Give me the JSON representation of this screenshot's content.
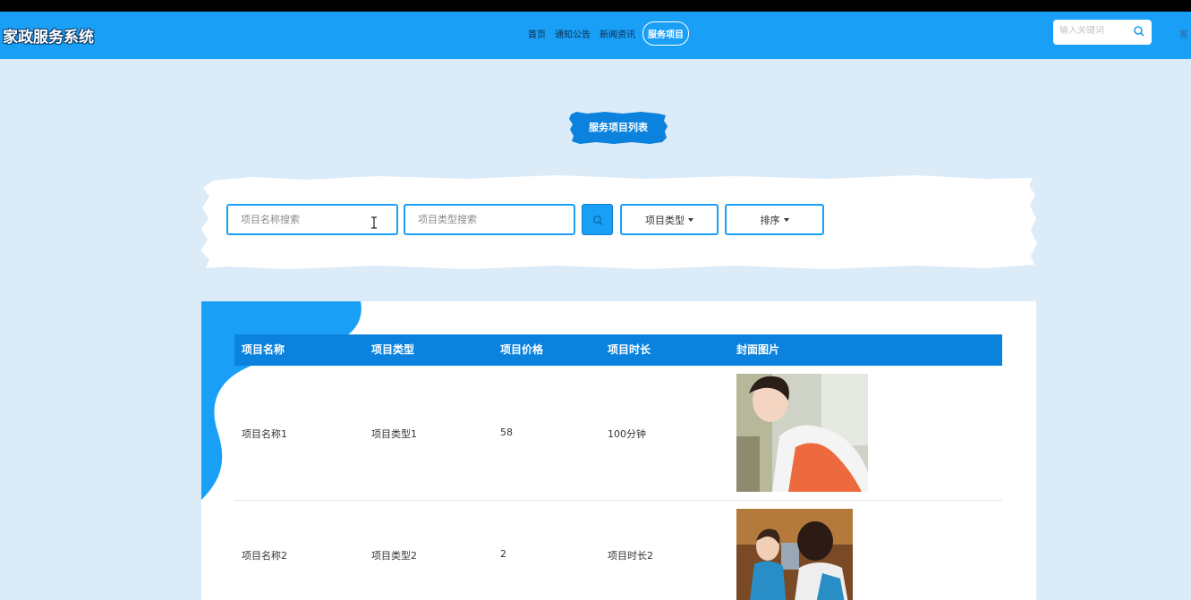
{
  "header": {
    "brand": "家政服务系统",
    "nav": [
      {
        "label": "首页"
      },
      {
        "label": "通知公告"
      },
      {
        "label": "新闻资讯"
      },
      {
        "label": "服务项目",
        "active": true
      }
    ],
    "search_placeholder": "输入关键词",
    "extra": "客"
  },
  "page_title": "服务项目列表",
  "filters": {
    "name_placeholder": "项目名称搜索",
    "type_placeholder": "项目类型搜索",
    "type_dropdown": "项目类型",
    "sort_dropdown": "排序"
  },
  "table": {
    "columns": [
      "项目名称",
      "项目类型",
      "项目价格",
      "项目时长",
      "封面图片"
    ],
    "rows": [
      {
        "name": "项目名称1",
        "type": "项目类型1",
        "price": "58",
        "duration": "100分钟",
        "cover": "cleaner-photo"
      },
      {
        "name": "项目名称2",
        "type": "项目类型2",
        "price": "2",
        "duration": "项目时长2",
        "cover": "service-staff-photo"
      }
    ]
  },
  "colors": {
    "primary": "#1a9ff7",
    "header_bg": "#0b83de",
    "page_bg": "#dcebf8"
  }
}
